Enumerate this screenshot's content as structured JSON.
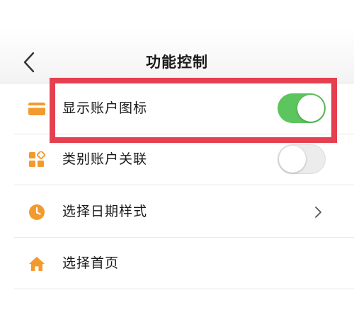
{
  "header": {
    "title": "功能控制",
    "back_icon": "chevron-left-icon"
  },
  "settings": [
    {
      "label": "显示账户图标",
      "icon": "card-icon",
      "control": "toggle",
      "on": true
    },
    {
      "label": "类别账户关联",
      "icon": "category-grid-icon",
      "control": "toggle",
      "on": false
    },
    {
      "label": "选择日期样式",
      "icon": "clock-icon",
      "control": "chevron"
    },
    {
      "label": "选择首页",
      "icon": "home-icon",
      "control": "none"
    }
  ],
  "colors": {
    "accent_orange": "#f39a2d",
    "toggle_on": "#5cc55d",
    "highlight_red": "#e5404f"
  }
}
